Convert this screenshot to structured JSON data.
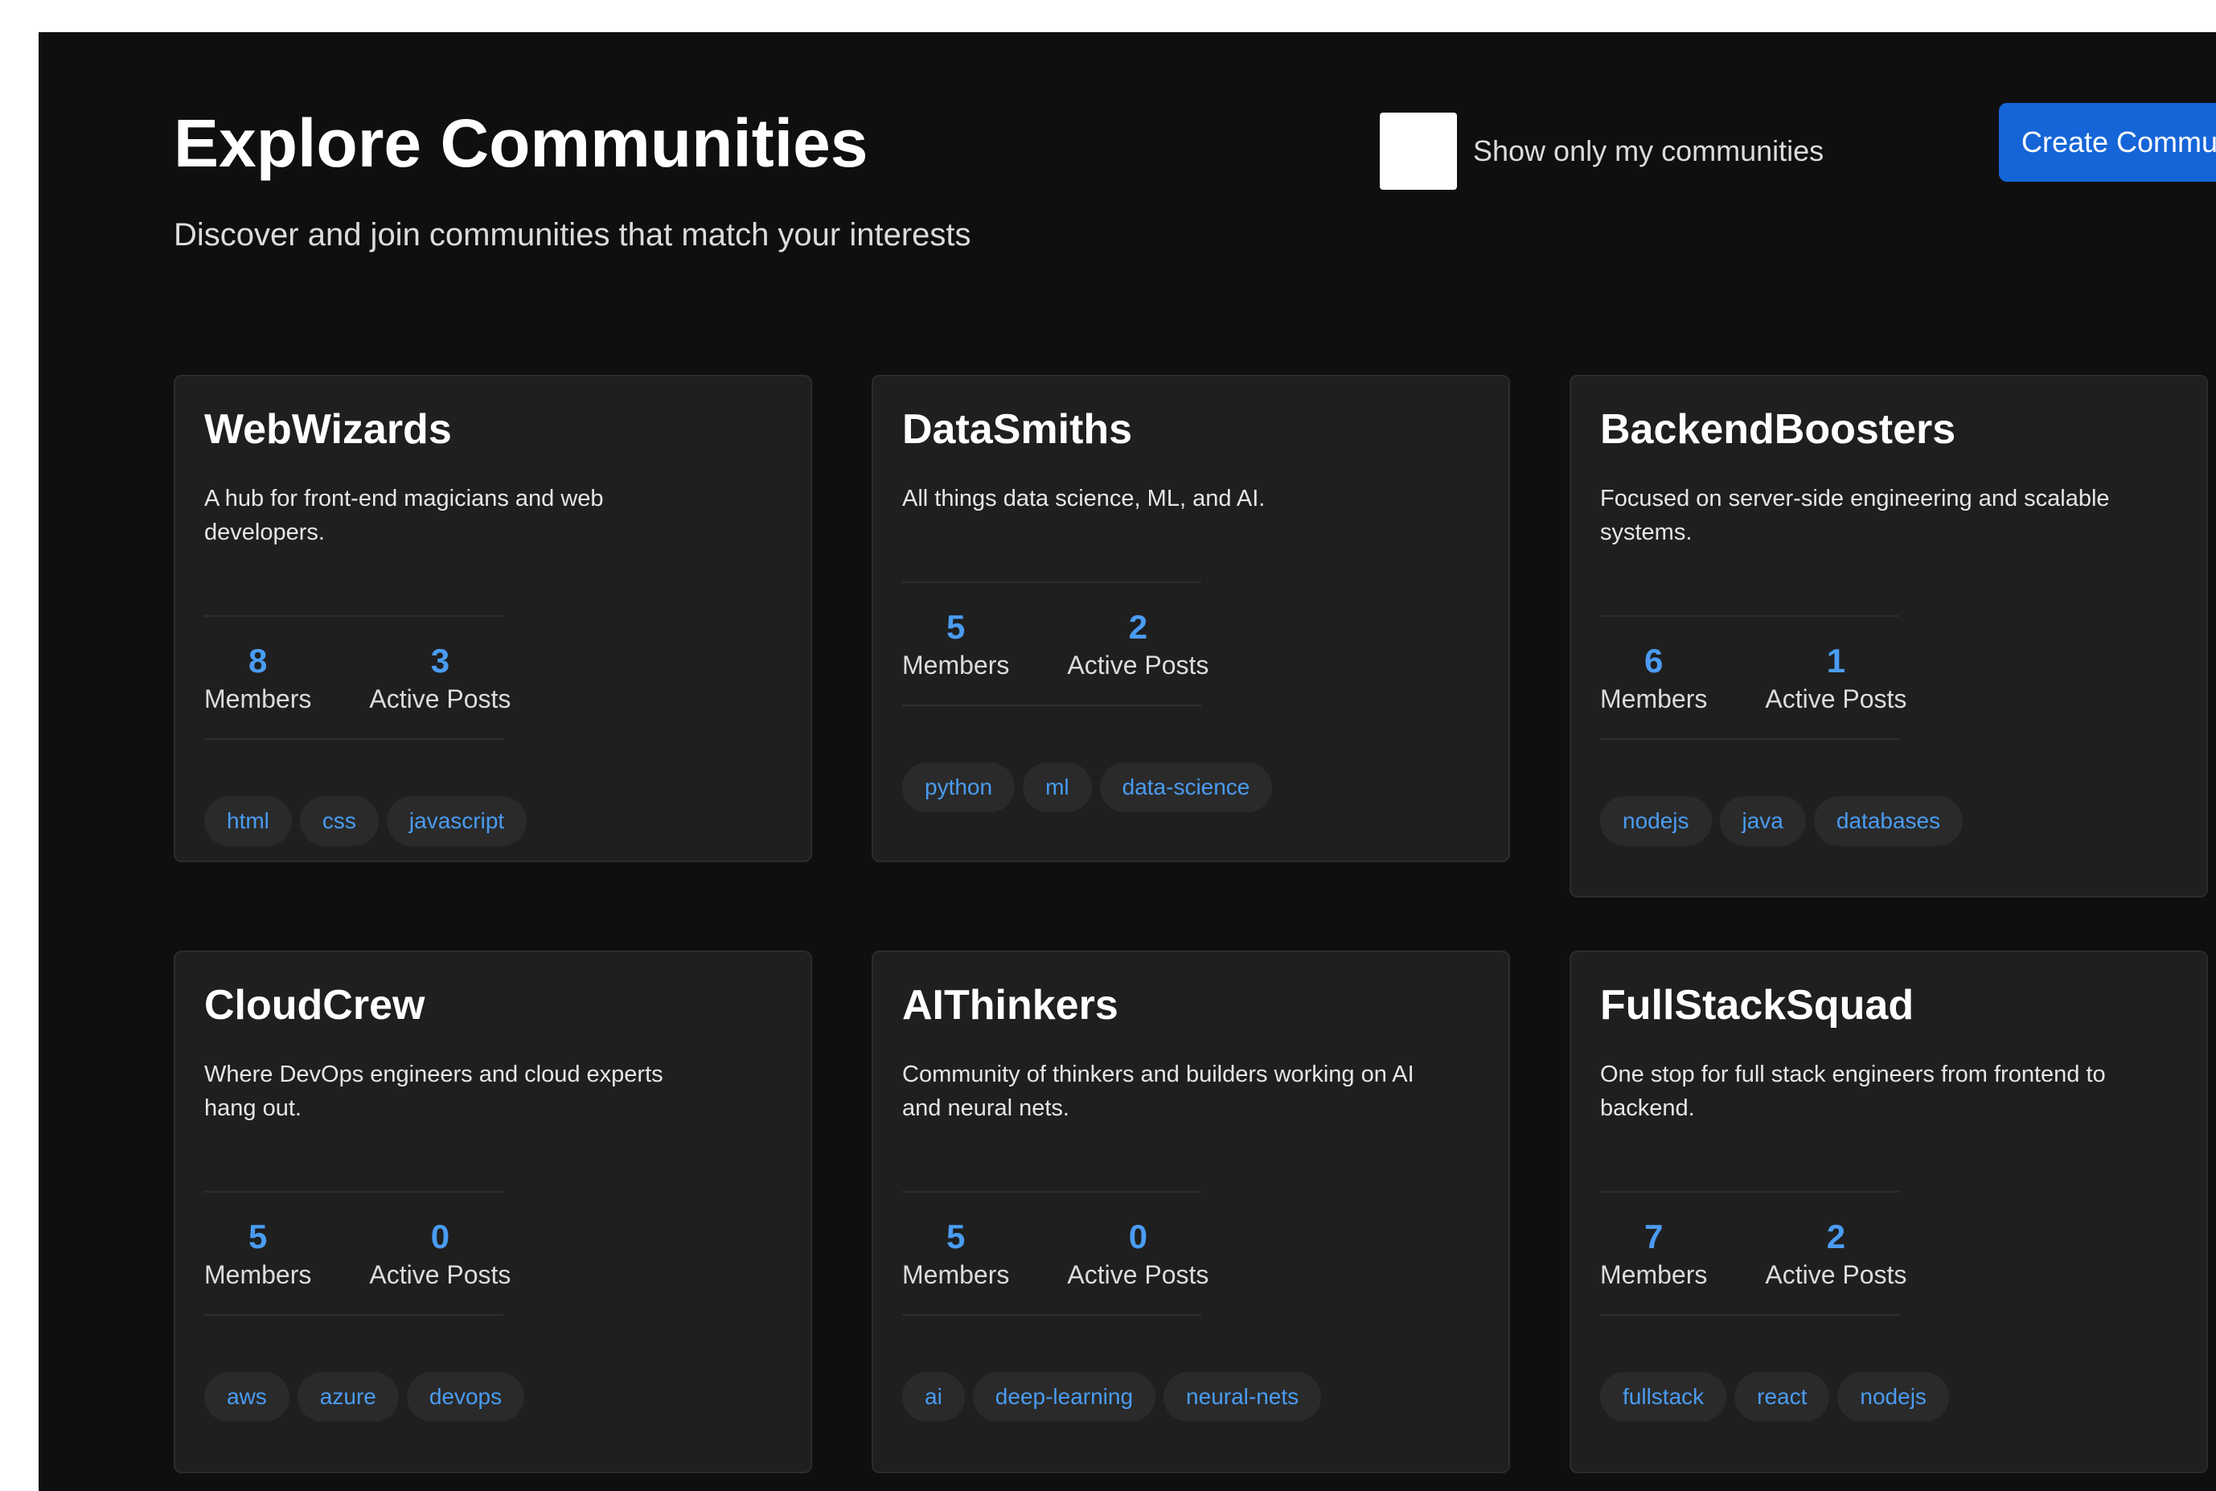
{
  "header": {
    "title": "Explore Communities",
    "subtitle": "Discover and join communities that match your interests",
    "filter_label": "Show only my communities",
    "create_label": "Create Community"
  },
  "colors": {
    "accent": "#1565d8",
    "stat_value": "#4a9cf2",
    "background": "#0f0f0f",
    "card": "#1f1f1f"
  },
  "stat_labels": {
    "members": "Members",
    "posts": "Active Posts"
  },
  "communities": [
    {
      "name": "WebWizards",
      "description": "A hub for front-end magicians and web developers.",
      "members": "8",
      "posts": "3",
      "tags": [
        "html",
        "css",
        "javascript"
      ]
    },
    {
      "name": "DataSmiths",
      "description": "All things data science, ML, and AI.",
      "members": "5",
      "posts": "2",
      "tags": [
        "python",
        "ml",
        "data-science"
      ]
    },
    {
      "name": "BackendBoosters",
      "description": "Focused on server-side engineering and scalable systems.",
      "members": "6",
      "posts": "1",
      "tags": [
        "nodejs",
        "java",
        "databases"
      ]
    },
    {
      "name": "CloudCrew",
      "description": "Where DevOps engineers and cloud experts hang out.",
      "members": "5",
      "posts": "0",
      "tags": [
        "aws",
        "azure",
        "devops"
      ]
    },
    {
      "name": "AIThinkers",
      "description": "Community of thinkers and builders working on AI and neural nets.",
      "members": "5",
      "posts": "0",
      "tags": [
        "ai",
        "deep-learning",
        "neural-nets"
      ]
    },
    {
      "name": "FullStackSquad",
      "description": "One stop for full stack engineers from frontend to backend.",
      "members": "7",
      "posts": "2",
      "tags": [
        "fullstack",
        "react",
        "nodejs"
      ]
    }
  ]
}
